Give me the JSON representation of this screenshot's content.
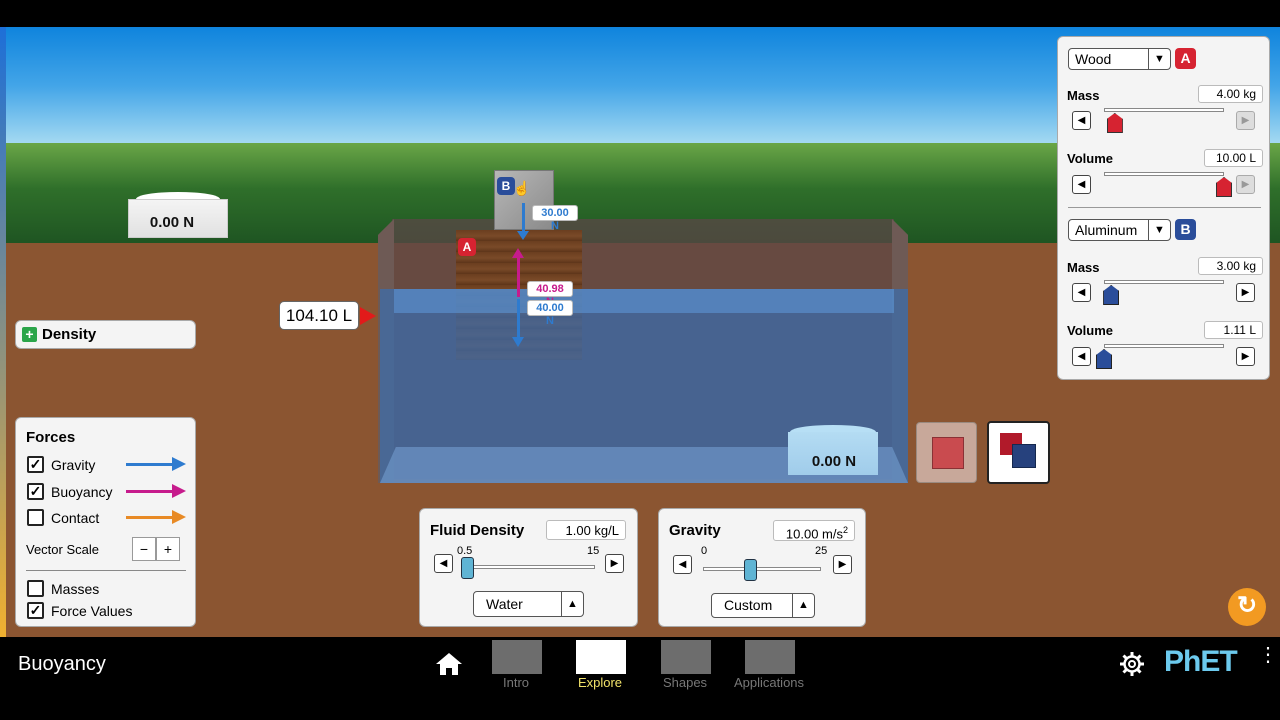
{
  "colors": {
    "gravity": "#2e7bcf",
    "buoyancy": "#c61b8c",
    "contact": "#e88a25",
    "block_a": "#d62331",
    "block_b": "#2a4d9a",
    "phet_brand": "#6ccaee"
  },
  "scale_left": {
    "reading": "0.00 N"
  },
  "scale_right": {
    "reading": "0.00 N"
  },
  "pool": {
    "volume_readout": "104.10 L"
  },
  "block_b": {
    "badge": "B",
    "gravity_force": "30.00 N"
  },
  "block_a": {
    "badge": "A",
    "buoyancy_force": "40.98 N",
    "gravity_force": "40.00 N"
  },
  "density_panel": {
    "label": "Density",
    "icon": "plus-icon"
  },
  "forces_panel": {
    "title": "Forces",
    "items": [
      {
        "label": "Gravity",
        "checked": true
      },
      {
        "label": "Buoyancy",
        "checked": true
      },
      {
        "label": "Contact",
        "checked": false
      }
    ],
    "vector_scale_label": "Vector Scale",
    "minus": "−",
    "plus": "+",
    "masses_label": "Masses",
    "masses_checked": false,
    "force_values_label": "Force Values",
    "force_values_checked": true
  },
  "fluid_panel": {
    "title": "Fluid Density",
    "value": "1.00 kg/L",
    "min_label": "0.5",
    "max_label": "15",
    "slider_fraction": 0.035,
    "selected": "Water"
  },
  "gravity_panel": {
    "title": "Gravity",
    "value": "10.00 m/s",
    "value_exp": "2",
    "min_label": "0",
    "max_label": "25",
    "slider_fraction": 0.4,
    "selected": "Custom"
  },
  "blocks_panel": {
    "a": {
      "material": "Wood",
      "badge": "A",
      "mass_label": "Mass",
      "mass_value": "4.00 kg",
      "mass_fraction": 0.09,
      "volume_label": "Volume",
      "volume_value": "10.00 L",
      "volume_fraction": 1.0
    },
    "b": {
      "material": "Aluminum",
      "badge": "B",
      "mass_label": "Mass",
      "mass_value": "3.00 kg",
      "mass_fraction": 0.06,
      "volume_label": "Volume",
      "volume_value": "1.11 L",
      "volume_fraction": 0.0
    }
  },
  "navbar": {
    "title": "Buoyancy",
    "tabs": [
      {
        "label": "Intro"
      },
      {
        "label": "Explore"
      },
      {
        "label": "Shapes"
      },
      {
        "label": "Applications"
      }
    ],
    "active_tab": "Explore",
    "brand": "PhET"
  }
}
